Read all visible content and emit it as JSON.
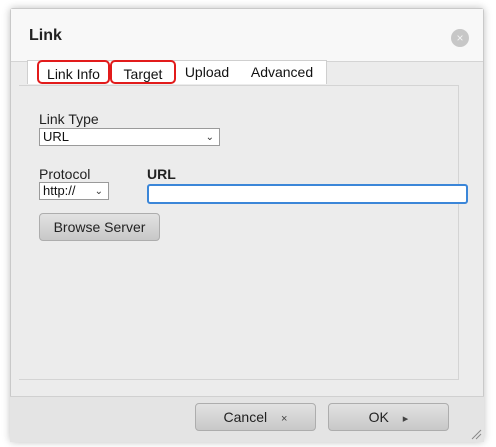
{
  "dialog": {
    "title": "Link",
    "close_symbol": "×"
  },
  "tabs": [
    {
      "label": "Link Info",
      "active": true,
      "highlighted": true
    },
    {
      "label": "Target",
      "active": false,
      "highlighted": true
    },
    {
      "label": "Upload",
      "active": false,
      "highlighted": false
    },
    {
      "label": "Advanced",
      "active": false,
      "highlighted": false
    }
  ],
  "link_info": {
    "link_type_label": "Link Type",
    "link_type_value": "URL",
    "protocol_label": "Protocol",
    "protocol_value": "http://",
    "url_label": "URL",
    "url_value": "",
    "browse_button": "Browse Server"
  },
  "footer": {
    "cancel_label": "Cancel",
    "cancel_icon": "×",
    "ok_label": "OK",
    "ok_icon": "▸"
  },
  "colors": {
    "highlight": "#e21b1b",
    "focus_border": "#3b86d8"
  }
}
